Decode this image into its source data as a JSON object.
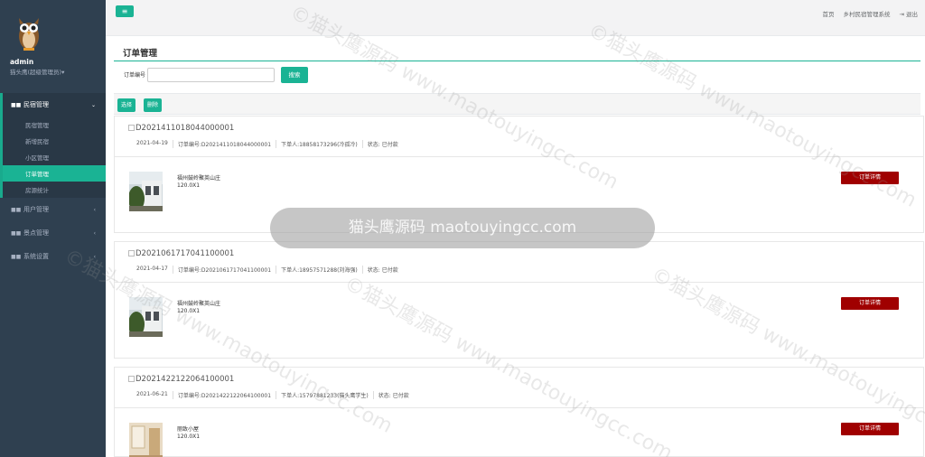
{
  "sidebar": {
    "admin_name": "admin",
    "admin_role": "猫头鹰(超级管理员)▾",
    "groups": [
      {
        "label": "民宿管理",
        "icon": "grid-icon",
        "chevron": "⌄"
      },
      {
        "label": "用户管理",
        "icon": "grid-icon",
        "chevron": "‹"
      },
      {
        "label": "景点管理",
        "icon": "grid-icon",
        "chevron": "‹"
      },
      {
        "label": "系统设置",
        "icon": "grid-icon",
        "chevron": "‹"
      }
    ],
    "sub_items": [
      "民宿管理",
      "新增民宿",
      "小区管理",
      "订单管理",
      "房源统计"
    ]
  },
  "topbar": {
    "menu_icon": "≡",
    "links": [
      "首页",
      "乡村民宿管理系统",
      "退出"
    ],
    "logout_icon": "⇥"
  },
  "main": {
    "title": "订单管理",
    "search_label": "订单编号",
    "search_value": "",
    "search_button": "搜索",
    "select_button": "选择",
    "delete_button": "删除",
    "orders": [
      {
        "order_no": "D2021411018044000001",
        "date": "2021-04-19",
        "order_no_label": "订单编号:D2021411018044000001",
        "buyer": "下单人:18858173296(冷孤冷)",
        "status": "状态: 已付款",
        "item_name": "福州鼓岭聚英山庄",
        "item_qty": "120.0X1",
        "detail_button": "订单详情"
      },
      {
        "order_no": "D2021061717041100001",
        "date": "2021-04-17",
        "order_no_label": "订单编号:D2021061717041100001",
        "buyer": "下单人:18957571288(刘海强)",
        "status": "状态: 已付款",
        "item_name": "福州鼓岭聚英山庄",
        "item_qty": "120.0X1",
        "detail_button": "订单详情"
      },
      {
        "order_no": "D2021422122064100001",
        "date": "2021-06-21",
        "order_no_label": "订单编号:D2021422122064100001",
        "buyer": "下单人:15797881233(猫头鹰学生)",
        "status": "状态: 已付款",
        "item_name": "丽致小屋",
        "item_qty": "120.0X1",
        "detail_button": "订单详情"
      }
    ]
  },
  "watermark": {
    "text": "©猫头鹰源码 www.maotouyingcc.com",
    "pill_text": "猫头鹰源码 maotouyingcc.com"
  },
  "colors": {
    "sidebar": "#2f4050",
    "accent": "#1ab394",
    "detail_button": "#a00000"
  }
}
